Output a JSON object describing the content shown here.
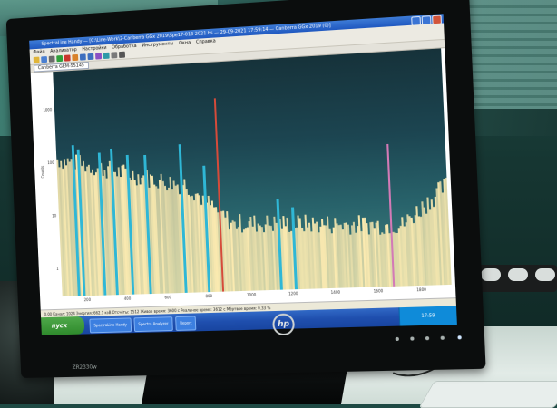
{
  "app": {
    "title": "SpectraLine Handy — [C:\\Line-Work\\2-Canberra GGx 2019\\Spe17-013 2021.bs — 29-09-2021 17:59:14 — Canberra GGx 2019 (0)]",
    "menu": [
      "Файл",
      "Анализатор",
      "Настройки",
      "Обработка",
      "Инструменты",
      "Окна",
      "Справка"
    ],
    "tab_label": "Canberra GEM-55145"
  },
  "toolbar_icons": [
    {
      "icon": "open-icon",
      "color": "#e0b53a"
    },
    {
      "icon": "save-icon",
      "color": "#4a7fd1"
    },
    {
      "icon": "print-icon",
      "color": "#6b6b6b"
    },
    {
      "icon": "start-icon",
      "color": "#2f9f3a"
    },
    {
      "icon": "stop-icon",
      "color": "#c9372c"
    },
    {
      "icon": "clear-icon",
      "color": "#d9822b"
    },
    {
      "icon": "zoom-in-icon",
      "color": "#3d6fbf"
    },
    {
      "icon": "zoom-out-icon",
      "color": "#3d6fbf"
    },
    {
      "icon": "peak-search-icon",
      "color": "#8a4fc4"
    },
    {
      "icon": "calibrate-icon",
      "color": "#2d9aa8"
    },
    {
      "icon": "report-icon",
      "color": "#7a7a7a"
    },
    {
      "icon": "settings-icon",
      "color": "#555555"
    }
  ],
  "plot": {
    "y_ticks": [
      "1000",
      "100",
      "10",
      "1"
    ],
    "x_ticks": [
      "200",
      "400",
      "600",
      "800",
      "1000",
      "1200",
      "1400",
      "1600",
      "1800"
    ],
    "y_axis_label": "Counts"
  },
  "status_text": "0.00  Канал: 1024   Энергия: 662.1 кэВ   Отсчёты: 1512   Живое время: 3600 с   Реальное время: 3612 с   Мёртвое время: 0.33 %",
  "taskbar": {
    "start_label": "пуск",
    "items": [
      "SpectraLine Handy",
      "Spectra Analyzer",
      "Report"
    ],
    "clock": "17:59"
  },
  "device": {
    "brand": "hp",
    "model": "ZR2330w"
  },
  "colors": {
    "plot_bg_top": "#16323a",
    "spectrum_fill": "#fbeab0",
    "peak_marker": "#2fb7d6",
    "selected_peak": "#d64b3a",
    "taskbar": "#245edb"
  }
}
